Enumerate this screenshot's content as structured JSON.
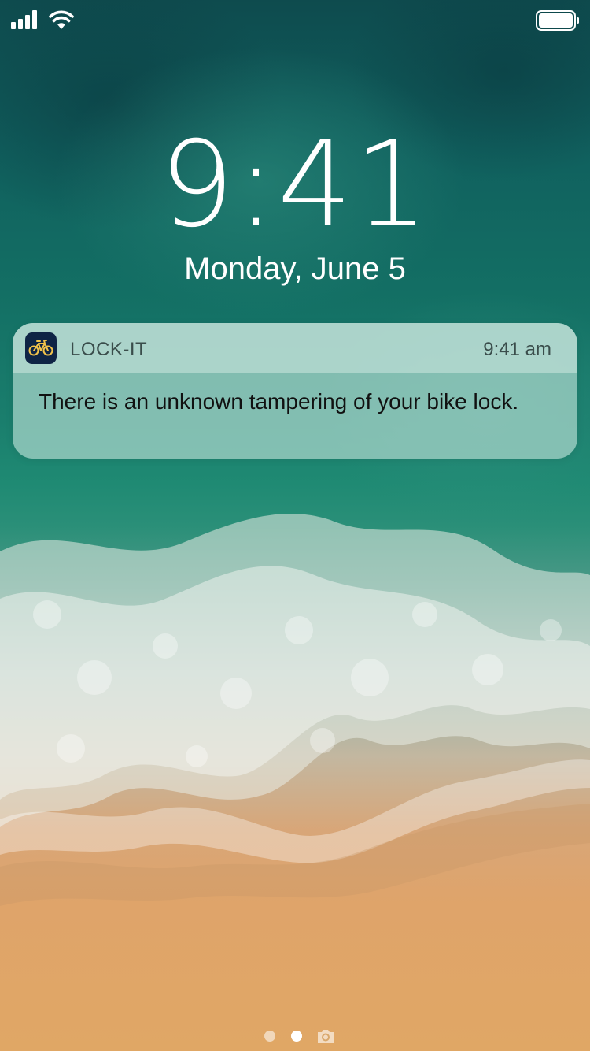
{
  "status_bar": {
    "signal_icon": "cellular-signal-icon",
    "wifi_icon": "wifi-icon",
    "battery_icon": "battery-icon"
  },
  "lock_screen": {
    "time": "9:41",
    "date": "Monday, June 5"
  },
  "notification": {
    "app_icon": "bike-icon",
    "app_name": "LOCK-IT",
    "time": "9:41 am",
    "message": "There is an unknown tampering of your bike lock."
  },
  "page_indicator": {
    "pages": 2,
    "active_page": 2,
    "camera_icon": "camera-icon"
  },
  "colors": {
    "app_icon_bg": "#0f2445",
    "app_icon_fg": "#f2c24a"
  }
}
